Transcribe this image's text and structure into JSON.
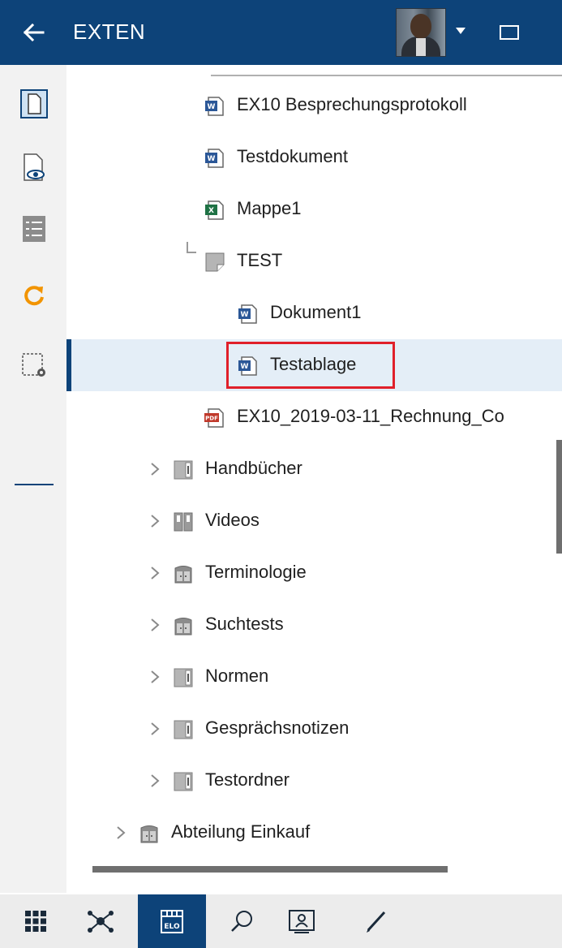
{
  "header": {
    "title": "EXTEN",
    "back_icon": "arrow-left-icon",
    "avatar": "user-avatar",
    "dropdown_icon": "caret-down-icon",
    "window_icon": "window-icon",
    "background": "#0d4379"
  },
  "left_toolbar": {
    "items": [
      {
        "name": "document-icon",
        "active": true
      },
      {
        "name": "preview-eye-icon",
        "active": false
      },
      {
        "name": "list-view-icon",
        "active": false
      },
      {
        "name": "refresh-icon",
        "active": false,
        "color": "#f29400"
      },
      {
        "name": "selection-settings-icon",
        "active": false
      }
    ]
  },
  "tree": {
    "items": [
      {
        "label": "EX10 Besprechungsprotokoll",
        "icon": "word-icon"
      },
      {
        "label": "Testdokument",
        "icon": "word-icon"
      },
      {
        "label": "Mappe1",
        "icon": "excel-icon"
      },
      {
        "label": "TEST",
        "icon": "folder-icon"
      },
      {
        "label": "Dokument1",
        "icon": "word-icon"
      },
      {
        "label": "Testablage",
        "icon": "word-icon",
        "selected": true
      },
      {
        "label": "EX10_2019-03-11_Rechnung_Co",
        "icon": "pdf-icon"
      },
      {
        "label": "Handbücher",
        "icon": "binder-icon"
      },
      {
        "label": "Videos",
        "icon": "binders-icon"
      },
      {
        "label": "Terminologie",
        "icon": "cabinet-icon"
      },
      {
        "label": "Suchtests",
        "icon": "cabinet-icon"
      },
      {
        "label": "Normen",
        "icon": "binder-icon"
      },
      {
        "label": "Gesprächsnotizen",
        "icon": "binder-icon"
      },
      {
        "label": "Testordner",
        "icon": "binder-icon"
      },
      {
        "label": "Abteilung Einkauf",
        "icon": "cabinet-icon"
      }
    ]
  },
  "bottom_bar": {
    "items": [
      {
        "name": "apps-grid-icon"
      },
      {
        "name": "network-icon"
      },
      {
        "name": "elo-repository-icon",
        "label": "ELO",
        "active": true
      },
      {
        "name": "search-icon"
      },
      {
        "name": "presentation-icon"
      },
      {
        "name": "edit-pen-icon"
      }
    ]
  },
  "colors": {
    "brand": "#0d4379",
    "selection": "#e4eef7",
    "highlight": "#e0202a",
    "word": "#2b5797",
    "excel": "#1f7245",
    "pdf": "#c0392b"
  }
}
